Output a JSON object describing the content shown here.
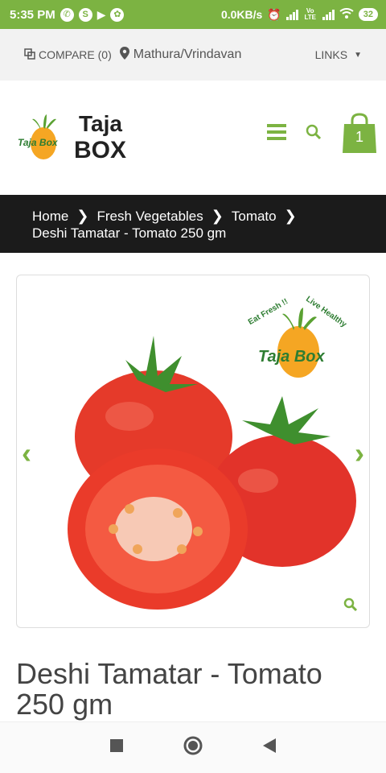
{
  "status_bar": {
    "time": "5:35 PM",
    "network_speed": "0.0KB/s",
    "battery": "32",
    "lte_label": "Vo LTE"
  },
  "topbar": {
    "compare_label": "COMPARE (0)",
    "location": "Mathura/Vrindavan",
    "links_label": "LINKS"
  },
  "header": {
    "logo_title_top": "Taja",
    "logo_title_bottom": "BOX",
    "logo_badge": "Taja Box",
    "cart_count": "1"
  },
  "breadcrumb": {
    "items": [
      "Home",
      "Fresh Vegetables",
      "Tomato"
    ],
    "current": "Deshi Tamatar - Tomato 250 gm"
  },
  "product": {
    "image_logo_text": "Taja Box",
    "image_slogan_left": "Eat Fresh !!",
    "image_slogan_right": "Live Healthy",
    "title": "Deshi Tamatar - Tomato 250 gm"
  },
  "colors": {
    "accent": "#7cb342",
    "breadcrumb_bg": "#1b1b1b",
    "tomato": "#e53a2a"
  }
}
